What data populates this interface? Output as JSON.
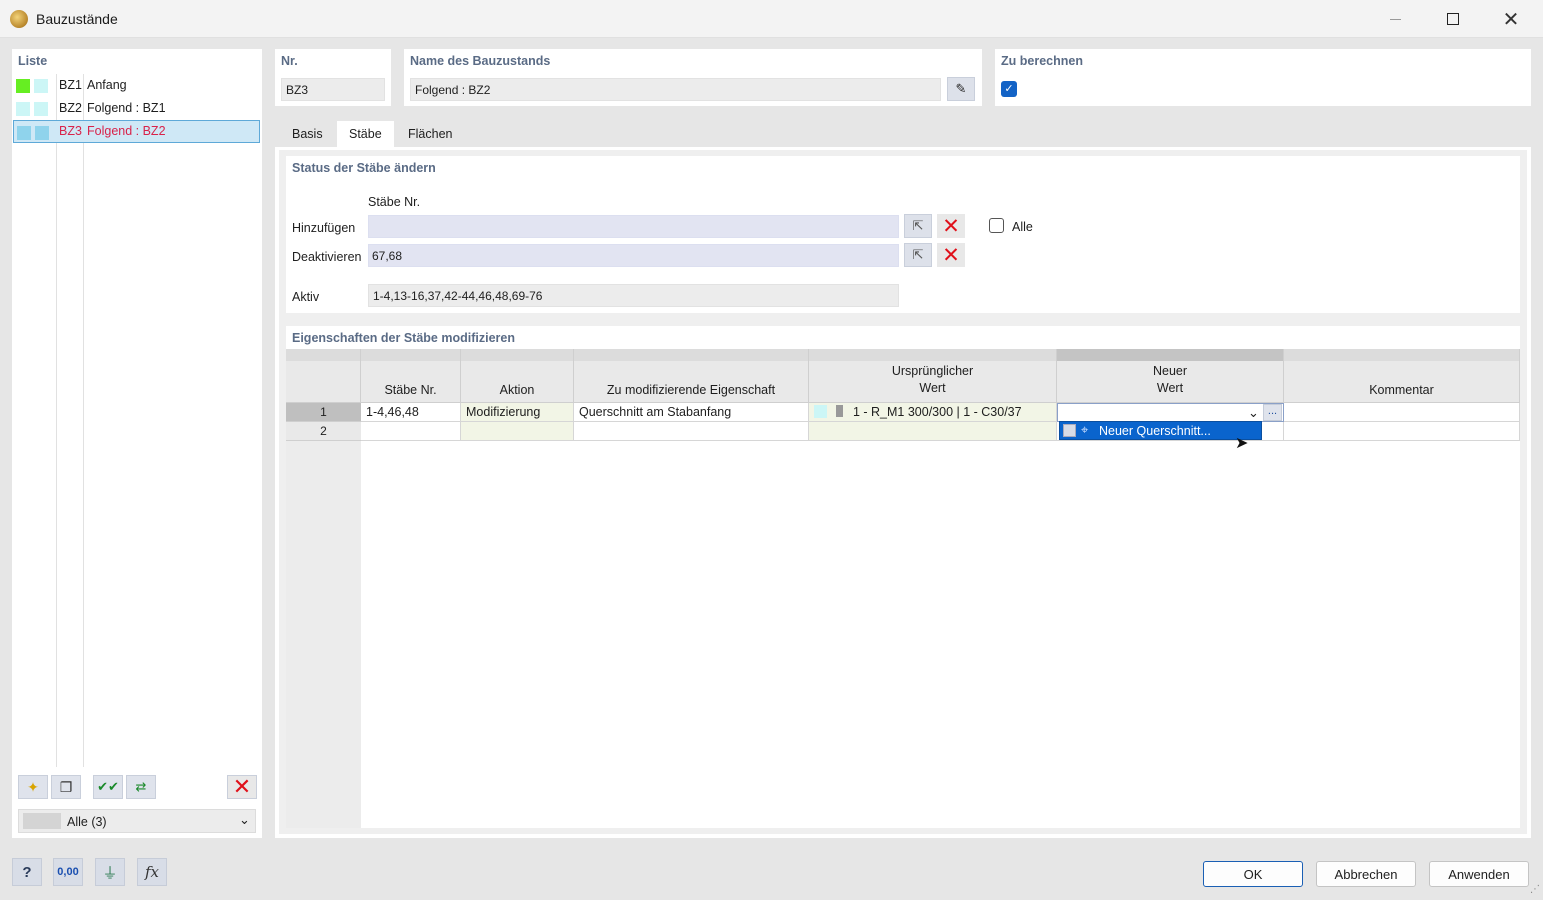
{
  "window": {
    "title": "Bauzustände"
  },
  "list": {
    "header": "Liste",
    "items": [
      {
        "id": "BZ1",
        "name": "Anfang",
        "color1": "#66ee22",
        "color2": "#ccf6f6"
      },
      {
        "id": "BZ2",
        "name": "Folgend : BZ1",
        "color1": "#ccf6f6",
        "color2": "#ccf6f6"
      },
      {
        "id": "BZ3",
        "name": "Folgend : BZ2",
        "color1": "#8fd3ec",
        "color2": "#8fd3ec"
      }
    ],
    "filter": "Alle (3)"
  },
  "nr": {
    "label": "Nr.",
    "value": "BZ3"
  },
  "name": {
    "label": "Name des Bauzustands",
    "value": "Folgend : BZ2"
  },
  "calc": {
    "label": "Zu berechnen",
    "checked": true
  },
  "tabs": [
    "Basis",
    "Stäbe",
    "Flächen"
  ],
  "status": {
    "title": "Status der Stäbe ändern",
    "col_label": "Stäbe Nr.",
    "add_label": "Hinzufügen",
    "add_value": "",
    "deact_label": "Deaktivieren",
    "deact_value": "67,68",
    "active_label": "Aktiv",
    "active_value": "1-4,13-16,37,42-44,46,48,69-76",
    "all_label": "Alle"
  },
  "props": {
    "title": "Eigenschaften der Stäbe modifizieren",
    "columns": {
      "c1": "Stäbe Nr.",
      "c2": "Aktion",
      "c3": "Zu modifizierende Eigenschaft",
      "c4a": "Ursprünglicher",
      "c4b": "Wert",
      "c5a": "Neuer",
      "c5b": "Wert",
      "c6": "Kommentar"
    },
    "rows": [
      {
        "n": "1",
        "members": "1-4,46,48",
        "action": "Modifizierung",
        "property": "Querschnitt am Stabanfang",
        "original": "1 - R_M1 300/300 | 1 - C30/37",
        "new": "",
        "comment": ""
      },
      {
        "n": "2",
        "members": "",
        "action": "",
        "property": "",
        "original": "",
        "new": "",
        "comment": ""
      }
    ],
    "dropdown_option": "Neuer Querschnitt...",
    "ellipsis": "..."
  },
  "buttons": {
    "ok": "OK",
    "cancel": "Abbrechen",
    "apply": "Anwenden"
  }
}
